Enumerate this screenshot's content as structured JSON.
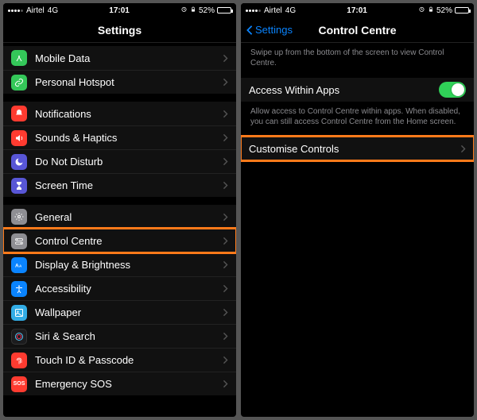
{
  "status": {
    "carrier": "Airtel",
    "network": "4G",
    "time": "17:01",
    "batteryPercent": "52%"
  },
  "left": {
    "title": "Settings",
    "groups": [
      [
        {
          "label": "Mobile Data",
          "icon": "antenna-icon",
          "color": "c-green"
        },
        {
          "label": "Personal Hotspot",
          "icon": "link-icon",
          "color": "c-green"
        }
      ],
      [
        {
          "label": "Notifications",
          "icon": "bell-icon",
          "color": "c-red"
        },
        {
          "label": "Sounds & Haptics",
          "icon": "speaker-icon",
          "color": "c-red2"
        },
        {
          "label": "Do Not Disturb",
          "icon": "moon-icon",
          "color": "c-purple"
        },
        {
          "label": "Screen Time",
          "icon": "hourglass-icon",
          "color": "c-purple"
        }
      ],
      [
        {
          "label": "General",
          "icon": "gear-icon",
          "color": "c-grey"
        },
        {
          "label": "Control Centre",
          "icon": "switches-icon",
          "color": "c-grey",
          "highlight": true
        },
        {
          "label": "Display & Brightness",
          "icon": "textsize-icon",
          "color": "c-blue"
        },
        {
          "label": "Accessibility",
          "icon": "accessibility-icon",
          "color": "c-blue"
        },
        {
          "label": "Wallpaper",
          "icon": "wallpaper-icon",
          "color": "c-cyan"
        },
        {
          "label": "Siri & Search",
          "icon": "siri-icon",
          "color": "c-black"
        },
        {
          "label": "Touch ID & Passcode",
          "icon": "fingerprint-icon",
          "color": "c-red"
        },
        {
          "label": "Emergency SOS",
          "icon": "sos-icon",
          "color": "c-sos"
        }
      ]
    ]
  },
  "right": {
    "back": "Settings",
    "title": "Control Centre",
    "intro": "Swipe up from the bottom of the screen to view Control Centre.",
    "toggleRow": {
      "label": "Access Within Apps",
      "on": true
    },
    "toggleHint": "Allow access to Control Centre within apps. When disabled, you can still access Control Centre from the Home screen.",
    "customise": {
      "label": "Customise Controls",
      "highlight": true
    }
  }
}
